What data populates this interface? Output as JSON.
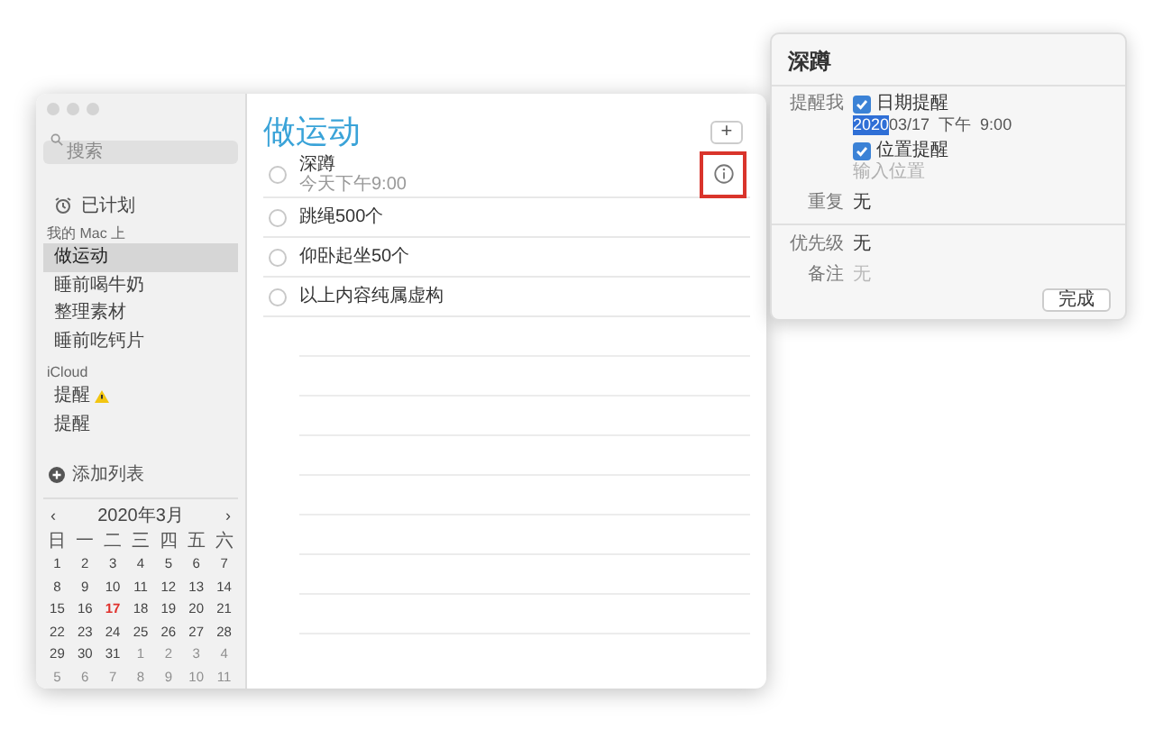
{
  "sidebar": {
    "search": {
      "placeholder": "搜索"
    },
    "scheduled": "已计划",
    "sections": [
      {
        "title": "我的 Mac 上",
        "lists": [
          {
            "name": "做运动",
            "selected": true,
            "warning": false
          },
          {
            "name": "睡前喝牛奶",
            "selected": false,
            "warning": false
          },
          {
            "name": "整理素材",
            "selected": false,
            "warning": false
          },
          {
            "name": "睡前吃钙片",
            "selected": false,
            "warning": false
          }
        ]
      },
      {
        "title": "iCloud",
        "lists": [
          {
            "name": "提醒",
            "selected": false,
            "warning": true
          },
          {
            "name": "提醒",
            "selected": false,
            "warning": false
          }
        ]
      }
    ],
    "add_list": "添加列表",
    "calendar": {
      "prev": "‹",
      "title": "2020年3月",
      "next": "›",
      "weekdays": [
        "日",
        "一",
        "二",
        "三",
        "四",
        "五",
        "六"
      ],
      "days": [
        {
          "label": "1",
          "current_month": true,
          "today": false
        },
        {
          "label": "2",
          "current_month": true,
          "today": false
        },
        {
          "label": "3",
          "current_month": true,
          "today": false
        },
        {
          "label": "4",
          "current_month": true,
          "today": false
        },
        {
          "label": "5",
          "current_month": true,
          "today": false
        },
        {
          "label": "6",
          "current_month": true,
          "today": false
        },
        {
          "label": "7",
          "current_month": true,
          "today": false
        },
        {
          "label": "8",
          "current_month": true,
          "today": false
        },
        {
          "label": "9",
          "current_month": true,
          "today": false
        },
        {
          "label": "10",
          "current_month": true,
          "today": false
        },
        {
          "label": "11",
          "current_month": true,
          "today": false
        },
        {
          "label": "12",
          "current_month": true,
          "today": false
        },
        {
          "label": "13",
          "current_month": true,
          "today": false
        },
        {
          "label": "14",
          "current_month": true,
          "today": false
        },
        {
          "label": "15",
          "current_month": true,
          "today": false
        },
        {
          "label": "16",
          "current_month": true,
          "today": false
        },
        {
          "label": "17",
          "current_month": true,
          "today": true
        },
        {
          "label": "18",
          "current_month": true,
          "today": false
        },
        {
          "label": "19",
          "current_month": true,
          "today": false
        },
        {
          "label": "20",
          "current_month": true,
          "today": false
        },
        {
          "label": "21",
          "current_month": true,
          "today": false
        },
        {
          "label": "22",
          "current_month": true,
          "today": false
        },
        {
          "label": "23",
          "current_month": true,
          "today": false
        },
        {
          "label": "24",
          "current_month": true,
          "today": false
        },
        {
          "label": "25",
          "current_month": true,
          "today": false
        },
        {
          "label": "26",
          "current_month": true,
          "today": false
        },
        {
          "label": "27",
          "current_month": true,
          "today": false
        },
        {
          "label": "28",
          "current_month": true,
          "today": false
        },
        {
          "label": "29",
          "current_month": true,
          "today": false
        },
        {
          "label": "30",
          "current_month": true,
          "today": false
        },
        {
          "label": "31",
          "current_month": true,
          "today": false
        },
        {
          "label": "1",
          "current_month": false,
          "today": false
        },
        {
          "label": "2",
          "current_month": false,
          "today": false
        },
        {
          "label": "3",
          "current_month": false,
          "today": false
        },
        {
          "label": "4",
          "current_month": false,
          "today": false
        },
        {
          "label": "5",
          "current_month": false,
          "today": false
        },
        {
          "label": "6",
          "current_month": false,
          "today": false
        },
        {
          "label": "7",
          "current_month": false,
          "today": false
        },
        {
          "label": "8",
          "current_month": false,
          "today": false
        },
        {
          "label": "9",
          "current_month": false,
          "today": false
        },
        {
          "label": "10",
          "current_month": false,
          "today": false
        },
        {
          "label": "11",
          "current_month": false,
          "today": false
        }
      ]
    }
  },
  "main": {
    "title": "做运动",
    "add_button": "+",
    "reminders": [
      {
        "title": "深蹲",
        "subtitle": "今天下午9:00",
        "info": true
      },
      {
        "title": "跳绳500个",
        "info": false
      },
      {
        "title": "仰卧起坐50个",
        "info": false
      },
      {
        "title": "以上内容纯属虚构",
        "info": false
      }
    ]
  },
  "popover": {
    "title": "深蹲",
    "remind_label": "提醒我",
    "date_alert": {
      "label": "日期提醒",
      "checked": true,
      "selected_part": "2020",
      "rest": "03/17  下午  9:00"
    },
    "location_alert": {
      "label": "位置提醒",
      "checked": true,
      "placeholder": "输入位置"
    },
    "repeat": {
      "label": "重复",
      "value": "无"
    },
    "priority": {
      "label": "优先级",
      "value": "无"
    },
    "notes": {
      "label": "备注",
      "placeholder": "无"
    },
    "done_button": "完成"
  }
}
